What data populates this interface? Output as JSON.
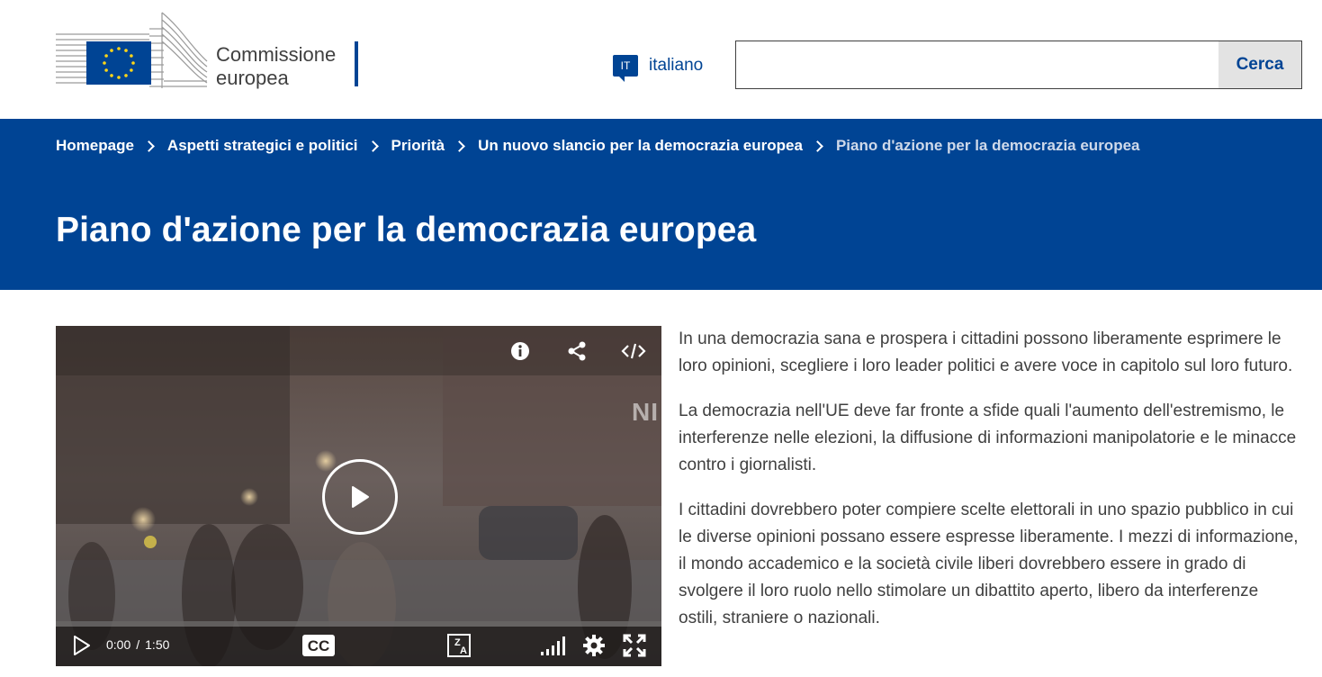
{
  "header": {
    "logo_line1": "Commissione",
    "logo_line2": "europea",
    "language": {
      "code": "IT",
      "label": "italiano"
    },
    "search": {
      "placeholder": "",
      "value": "",
      "button_label": "Cerca"
    }
  },
  "breadcrumb": [
    {
      "label": "Homepage"
    },
    {
      "label": "Aspetti strategici e politici"
    },
    {
      "label": "Priorità"
    },
    {
      "label": "Un nuovo slancio per la democrazia europea"
    },
    {
      "label": "Piano d'azione per la democrazia europea"
    }
  ],
  "page_title": "Piano d'azione per la democrazia europea",
  "video": {
    "current_time": "0:00",
    "separator": "/",
    "duration": "1:50",
    "progress": 0,
    "overlay_mark": "NI",
    "top_controls": [
      "info-icon",
      "share-icon",
      "embed-code-icon"
    ],
    "bottom_controls": [
      "play-icon",
      "closed-captions-icon",
      "translate-icon",
      "quality-icon",
      "settings-icon",
      "fullscreen-icon"
    ]
  },
  "paragraphs": [
    "In una democrazia sana e prospera i cittadini possono liberamente esprimere le loro opinioni, scegliere i loro leader politici e avere voce in capitolo sul loro futuro.",
    "La democrazia nell'UE deve far fronte a sfide quali l'aumento dell'estremismo, le interferenze nelle elezioni, la diffusione di informazioni manipolatorie e le minacce contro i giornalisti.",
    "I cittadini dovrebbero poter compiere scelte elettorali in uno spazio pubblico in cui le diverse opinioni possano essere espresse liberamente. I mezzi di informazione, il mondo accademico e la società civile liberi dovrebbero essere in grado di svolgere il loro ruolo nello stimolare un dibattito aperto, libero da interferenze ostili, straniere o nazionali."
  ],
  "colors": {
    "primary_blue": "#004494",
    "eu_flag_blue": "#004494",
    "eu_star_yellow": "#FFD617",
    "text": "#404040",
    "search_button_bg": "#E3E3E3"
  }
}
